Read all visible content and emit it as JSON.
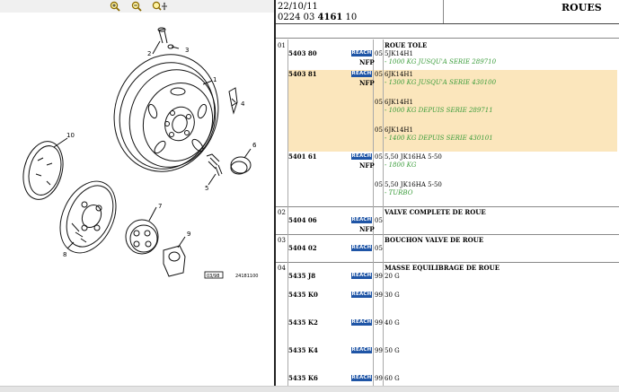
{
  "toolbar": {
    "icons": [
      "zoom-in-icon",
      "zoom-out-icon",
      "zoom-pan-icon"
    ]
  },
  "diagram": {
    "callouts": [
      "1",
      "2",
      "3",
      "4",
      "5",
      "6",
      "7",
      "8",
      "9",
      "10"
    ],
    "stamp": "03/98",
    "ref": "24181100"
  },
  "header": {
    "date": "22/10/11",
    "code_prefix": "0224 03 ",
    "code_bold": "4161",
    "code_suffix": " 10",
    "title": "ROUES"
  },
  "sections": [
    {
      "num": "01",
      "title": "ROUE TOLE",
      "items": [
        {
          "ref": "5403 80",
          "badge": "REACH",
          "nfp": "NFP",
          "lines": [
            {
              "qty": "05",
              "desc": "5JK14H1",
              "note": "- 1000 KG JUSQU'A SERIE 289710"
            }
          ]
        },
        {
          "ref": "5403 81",
          "badge": "REACH",
          "nfp": "NFP",
          "lines": [
            {
              "qty": "05",
              "desc": "6JK14H1",
              "note": "- 1300 KG JUSQU'A SERIE 430100"
            },
            {
              "qty": "05",
              "desc": "6JK14H1",
              "note": "- 1000 KG DEPUIS SERIE 289711"
            },
            {
              "qty": "05",
              "desc": "6JK14H1",
              "note": "- 1400 KG DEPUIS SERIE 430101"
            }
          ]
        },
        {
          "ref": "5401 61",
          "badge": "REACH",
          "nfp": "NFP",
          "lines": [
            {
              "qty": "05",
              "desc": "5,50 JK16HA 5-50",
              "note": "- 1800 KG"
            },
            {
              "qty": "05",
              "desc": "5,50 JK16HA 5-50",
              "note": "- TURBO"
            }
          ]
        }
      ]
    },
    {
      "num": "02",
      "title": "VALVE COMPLETE DE ROUE",
      "items": [
        {
          "ref": "5404 06",
          "badge": "REACH",
          "nfp": "NFP",
          "lines": [
            {
              "qty": "05",
              "desc": "",
              "note": ""
            }
          ]
        }
      ]
    },
    {
      "num": "03",
      "title": "BOUCHON VALVE DE ROUE",
      "items": [
        {
          "ref": "5404 02",
          "badge": "REACH",
          "nfp": "",
          "lines": [
            {
              "qty": "05",
              "desc": "",
              "note": ""
            }
          ]
        }
      ]
    },
    {
      "num": "04",
      "title": "MASSE EQUILIBRAGE DE ROUE",
      "items": [
        {
          "ref": "5435 J8",
          "badge": "REACH",
          "nfp": "",
          "lines": [
            {
              "qty": "99",
              "desc": "20 G",
              "note": ""
            }
          ]
        },
        {
          "ref": "5435 K0",
          "badge": "REACH",
          "nfp": "",
          "lines": [
            {
              "qty": "99",
              "desc": "30 G",
              "note": ""
            }
          ]
        },
        {
          "ref": "5435 K2",
          "badge": "REACH",
          "nfp": "",
          "lines": [
            {
              "qty": "99",
              "desc": "40 G",
              "note": ""
            }
          ]
        },
        {
          "ref": "5435 K4",
          "badge": "REACH",
          "nfp": "",
          "lines": [
            {
              "qty": "99",
              "desc": "50 G",
              "note": ""
            }
          ]
        },
        {
          "ref": "5435 K6",
          "badge": "REACH",
          "nfp": "",
          "lines": [
            {
              "qty": "99",
              "desc": "60 G",
              "note": ""
            }
          ]
        }
      ]
    }
  ],
  "colors": {
    "highlight": "#fbe6bc",
    "reach_badge": "#1f55a6",
    "note_green": "#3a9c3a"
  }
}
